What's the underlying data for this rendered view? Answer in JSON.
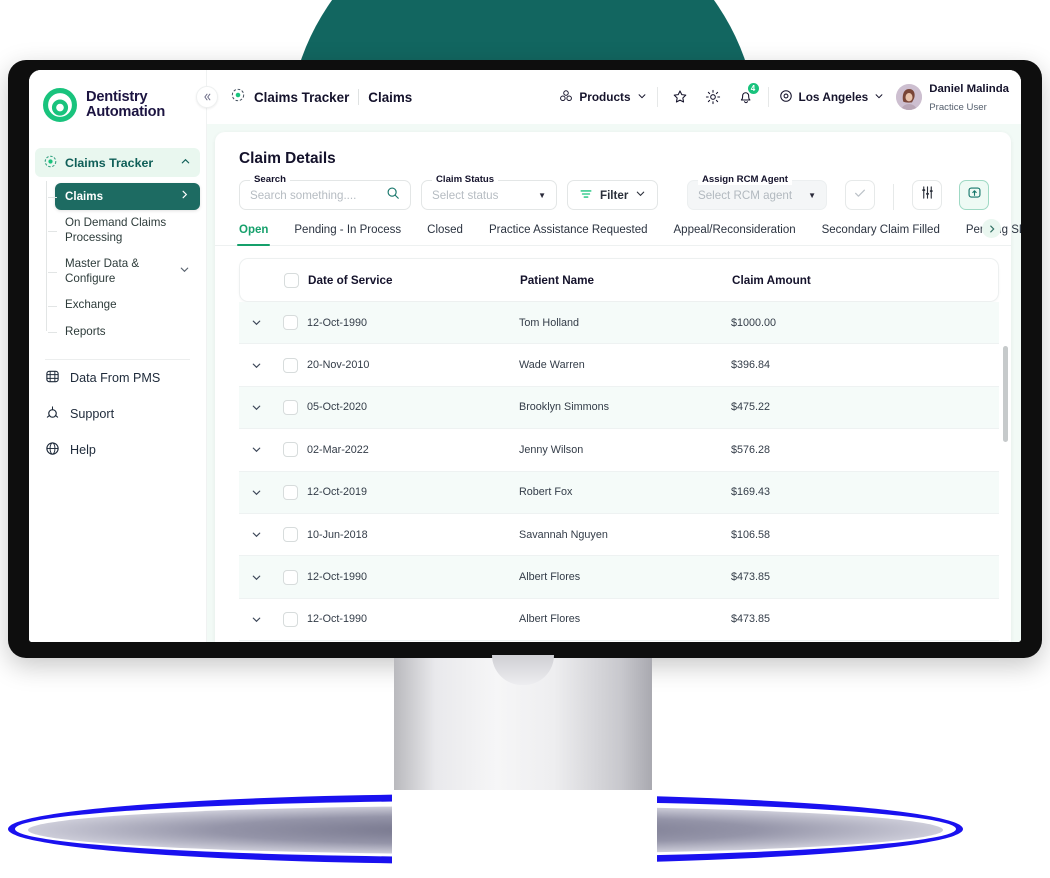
{
  "brand": {
    "line1": "Dentistry",
    "line2": "Automation",
    "logo_icon": "dentistry-logo-icon"
  },
  "sidebar": {
    "group": {
      "label": "Claims Tracker",
      "icon": "target-icon",
      "chevron": "chevron-up-icon"
    },
    "items": [
      {
        "label": "Claims",
        "active": true,
        "arrow": "chevron-right-icon"
      },
      {
        "label": "On Demand Claims Processing",
        "active": false
      },
      {
        "label": "Master Data & Configure",
        "active": false,
        "chevron": "chevron-down-icon"
      },
      {
        "label": "Exchange",
        "active": false
      },
      {
        "label": "Reports",
        "active": false
      }
    ],
    "lower_items": [
      {
        "label": "Data From PMS",
        "icon": "database-icon"
      },
      {
        "label": "Support",
        "icon": "support-icon"
      },
      {
        "label": "Help",
        "icon": "help-globe-icon"
      }
    ]
  },
  "topbar": {
    "collapse_icon": "double-chevron-left-icon",
    "breadcrumb_icon": "target-icon",
    "breadcrumb_main": "Claims Tracker",
    "breadcrumb_sub": "Claims",
    "products_label": "Products",
    "products_icon": "products-icon",
    "products_caret": "chevron-down-icon",
    "star_icon": "star-icon",
    "gear_icon": "gear-icon",
    "bell_icon": "bell-icon",
    "notification_count": "4",
    "location_icon": "location-pin-icon",
    "location_label": "Los Angeles",
    "location_caret": "chevron-down-icon",
    "avatar": "user-avatar",
    "user_name": "Daniel Malinda",
    "user_role": "Practice User"
  },
  "panel": {
    "title": "Claim Details",
    "search": {
      "legend": "Search",
      "placeholder": "Search something....",
      "icon": "search-icon"
    },
    "claim_status": {
      "legend": "Claim Status",
      "placeholder": "Select status",
      "caret": "triangle-down-icon"
    },
    "filter": {
      "label": "Filter",
      "icon": "filter-icon",
      "caret": "chevron-down-icon"
    },
    "rcm": {
      "legend": "Assign RCM Agent",
      "placeholder": "Select RCM agent",
      "caret": "triangle-down-icon"
    },
    "confirm_icon": "check-icon",
    "settings_icon": "sliders-icon",
    "export_icon": "upload-box-icon"
  },
  "tabs": {
    "items": [
      {
        "label": "Open",
        "active": true
      },
      {
        "label": "Pending - In Process",
        "active": false
      },
      {
        "label": "Closed",
        "active": false
      },
      {
        "label": "Practice Assistance Requested",
        "active": false
      },
      {
        "label": "Appeal/Reconsideration",
        "active": false
      },
      {
        "label": "Secondary Claim Filled",
        "active": false
      },
      {
        "label": "Pending SDB",
        "active": false
      }
    ],
    "next_icon": "chevron-right-icon"
  },
  "table": {
    "columns": [
      "Date of Service",
      "Patient Name",
      "Claim Amount"
    ],
    "rows": [
      {
        "date": "12-Oct-1990",
        "name": "Tom Holland",
        "amount": "$1000.00"
      },
      {
        "date": "20-Nov-2010",
        "name": "Wade Warren",
        "amount": "$396.84"
      },
      {
        "date": "05-Oct-2020",
        "name": "Brooklyn Simmons",
        "amount": "$475.22"
      },
      {
        "date": "02-Mar-2022",
        "name": "Jenny Wilson",
        "amount": "$576.28"
      },
      {
        "date": "12-Oct-2019",
        "name": "Robert Fox",
        "amount": "$169.43"
      },
      {
        "date": "10-Jun-2018",
        "name": "Savannah Nguyen",
        "amount": "$106.58"
      },
      {
        "date": "12-Oct-1990",
        "name": "Albert Flores",
        "amount": "$473.85"
      },
      {
        "date": "12-Oct-1990",
        "name": "Albert Flores",
        "amount": "$473.85"
      }
    ]
  },
  "colors": {
    "brand_green": "#15a06b",
    "deep_teal": "#1d6b62",
    "bg_circle": "#126660",
    "shadow_outline": "#1a11ef",
    "content_bg": "#f2faf6",
    "row_alt": "#f5fbf9"
  }
}
